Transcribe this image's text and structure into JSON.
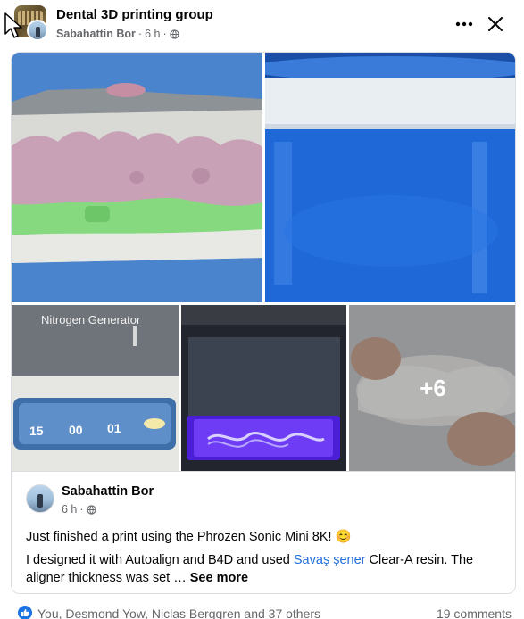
{
  "header": {
    "group_name": "Dental 3D printing group",
    "author": "Sabahattin Bor",
    "time": "6 h",
    "separator": "·"
  },
  "photos": {
    "photo3_label": "Nitrogen Generator",
    "photo3_display": [
      "15",
      "00",
      "01"
    ],
    "more_count": "+6"
  },
  "shared_post": {
    "author": "Sabahattin Bor",
    "time": "6 h",
    "separator": "·",
    "line1": "Just finished a print using the Phrozen Sonic Mini 8K! 😊",
    "line2_prefix": "I designed it with Autoalign and B4D and used ",
    "mention": "Savaş şener",
    "line2_suffix": " Clear-A resin. The aligner thickness was set … ",
    "see_more": "See more"
  },
  "footer": {
    "reactors": "You, Desmond Yow, Niclas Berggren and 37 others",
    "comments": "19 comments"
  },
  "colors": {
    "like_blue": "#1b74e4",
    "mention_blue": "#216fdb",
    "secondary_text": "#65676b"
  }
}
